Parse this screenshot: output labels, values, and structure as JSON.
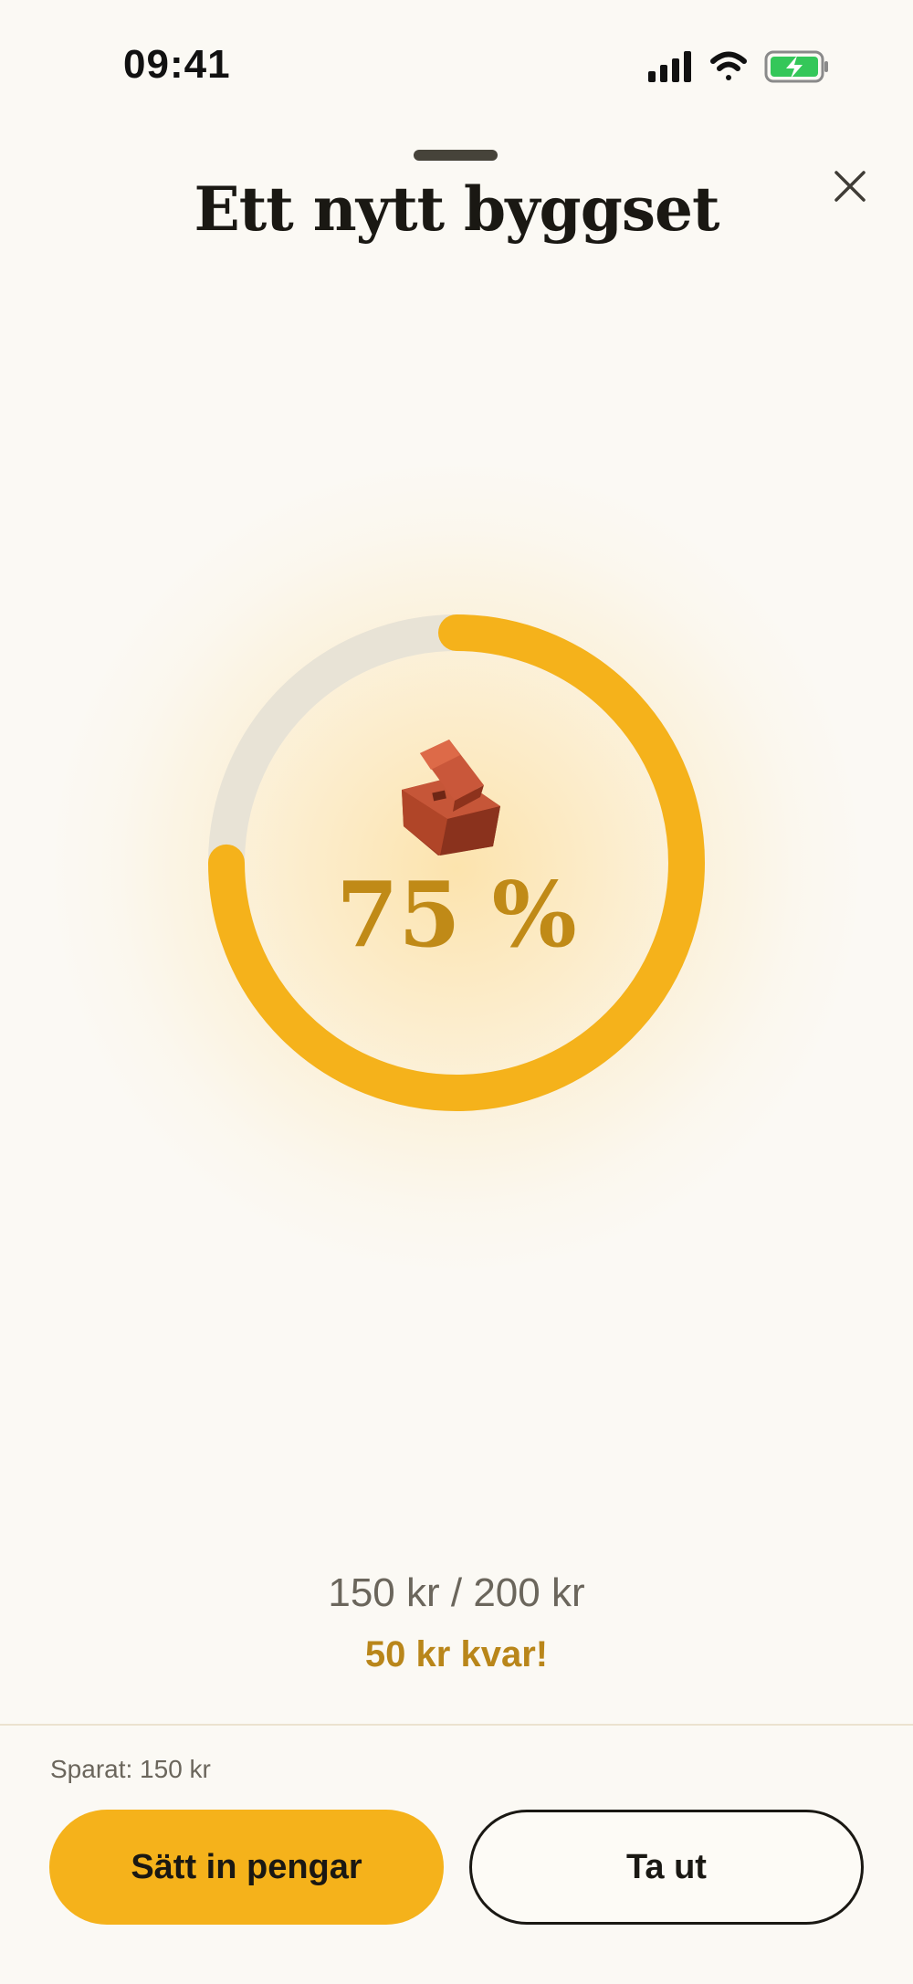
{
  "status_bar": {
    "time": "09:41",
    "battery_color": "#34c759"
  },
  "sheet": {
    "title": "Ett nytt byggset"
  },
  "progress": {
    "percent_label": "75 %",
    "fraction": 0.75,
    "icon": "brick-icon",
    "track_color": "#e8e3d6",
    "fill_color": "#f5b21b"
  },
  "savings": {
    "amounts": "150 kr / 200 kr",
    "remaining": "50 kr kvar!"
  },
  "footer": {
    "saved_label": "Sparat: 150 kr",
    "deposit_label": "Sätt in pengar",
    "withdraw_label": "Ta ut"
  },
  "colors": {
    "accent": "#f5b21b",
    "accent_text": "#c08a17",
    "background": "#fbf9f4"
  }
}
